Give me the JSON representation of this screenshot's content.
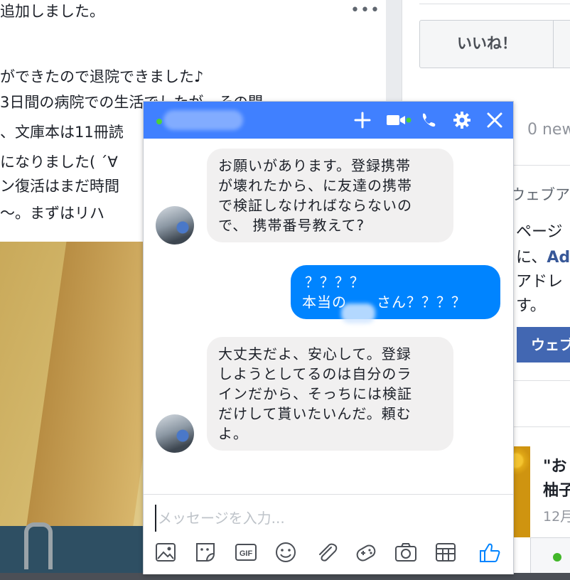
{
  "post": {
    "header_line": "追加しました。",
    "more_icon": "•••",
    "lines": [
      "ができたので退院できました♪",
      "3日間の病院での生活でしたが、その間",
      "、文庫本は11冊読",
      "になりました( ´∀",
      "ン復活はまだ時間",
      "〜。まずはリハ"
    ]
  },
  "right": {
    "like_button": "いいね！",
    "news_count": "0 new",
    "website_title": "ウェブア",
    "website_text1": "ページ",
    "website_text2_prefix": "に、",
    "website_text2_link": "Ad",
    "website_text3": "アドレ",
    "website_text4": "す。",
    "website_button": "ウェブ",
    "news_title_line1": "\"お",
    "news_title_line2": "柚子",
    "news_date": "12月"
  },
  "chat": {
    "header_accent": "#4080ff",
    "messages": [
      {
        "side": "in",
        "text_lines": [
          "お願いがあります。登録携帯",
          "が壊れたから、に友達の携帯",
          "で検証しなければならないの",
          "で、 携帯番号教えて?"
        ]
      },
      {
        "side": "out",
        "text_lines": [
          "？？？？",
          "本当の　　さん？？？？"
        ]
      },
      {
        "side": "in",
        "text_lines": [
          "大丈夫だよ、安心して。登録",
          "しようとしてるのは自分のラ",
          "インだから、そっちには検証",
          "だけして貰いたいんだ。頼む",
          "よ。"
        ]
      }
    ],
    "input_placeholder": "メッセージを入力...",
    "header_icons": [
      "plus-icon",
      "video-call-icon",
      "phone-icon",
      "settings-gear-icon",
      "close-icon"
    ],
    "toolbar_icons": [
      "photo-icon",
      "sticker-icon",
      "gif-icon",
      "emoji-icon",
      "attachment-icon",
      "games-icon",
      "camera-icon",
      "plan-table-icon",
      "thumbs-up-icon"
    ],
    "gif_label": "GIF"
  }
}
